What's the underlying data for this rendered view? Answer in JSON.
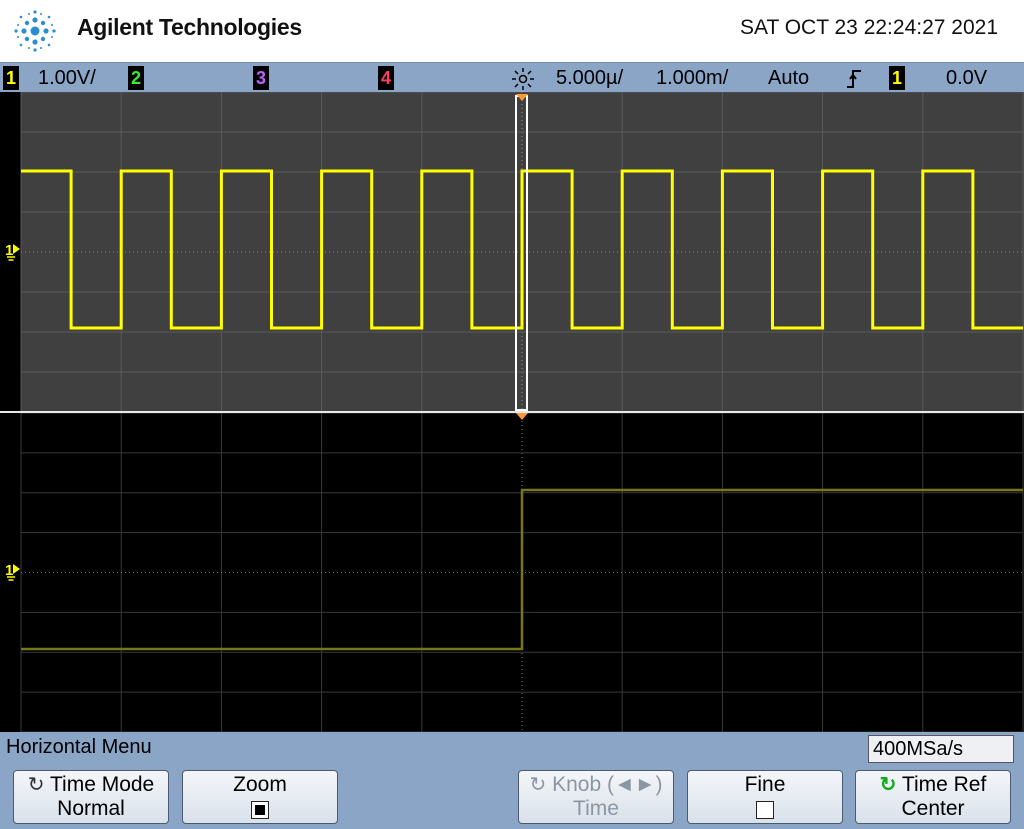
{
  "header": {
    "brand": "Agilent Technologies",
    "datetime": "SAT OCT 23 22:24:27 2021"
  },
  "status": {
    "ch1": {
      "num": "1",
      "scale": "1.00V/",
      "color": "#ffff00"
    },
    "ch2": {
      "num": "2",
      "color": "#33ee33"
    },
    "ch3": {
      "num": "3",
      "color": "#c060ff"
    },
    "ch4": {
      "num": "4",
      "color": "#ff4060"
    },
    "timebase": "5.000µ/",
    "delay": "1.000m/",
    "trigger_mode": "Auto",
    "trigger_source": "1",
    "trigger_level": "0.0V",
    "run_icon": "acquire-icon",
    "edge_icon": "rising-edge-icon"
  },
  "display": {
    "trace_color": "#ffff00",
    "zoom_trace_color": "#77771a",
    "upper_pane_bg": "#404040",
    "lower_pane_bg": "#000000",
    "marker_color": "#ff9933"
  },
  "menu": {
    "title": "Horizontal Menu",
    "sample_rate": "400MSa/s",
    "softkeys": [
      {
        "line1": "Time Mode",
        "line2": "Normal",
        "icon": "knob-icon"
      },
      {
        "line1": "Zoom",
        "line2": "",
        "checked": true
      },
      {
        "line1": "Knob (◄►)",
        "line2": "Time",
        "icon": "knob-icon",
        "disabled": true
      },
      {
        "line1": "Fine",
        "line2": "",
        "checked": false
      },
      {
        "line1": "Time Ref",
        "line2": "Center",
        "icon": "green-knob-icon"
      }
    ]
  }
}
